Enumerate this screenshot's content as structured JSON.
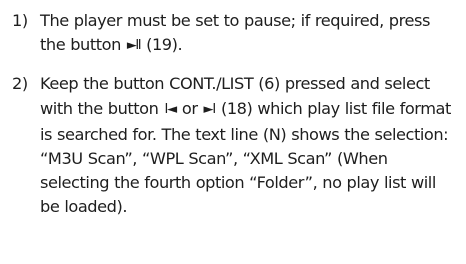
{
  "steps": [
    {
      "number": "1)",
      "text_1": "The player must be set to pause; if required, press the button ",
      "play_pause_glyph": "►II",
      "text_2": " (19)."
    },
    {
      "number": "2)",
      "text_1": "Keep the button CONT./LIST (6) pressed and select with the button ",
      "prev_glyph": "I◄",
      "text_2": " or ",
      "next_glyph": "►I",
      "text_3": " (18) which play list file format is searched for. The text line (N) shows the selection: “M3U Scan”, “WPL Scan”, “XML Scan” (When selecting the fourth option “Folder”, no play list will be loaded)."
    }
  ]
}
